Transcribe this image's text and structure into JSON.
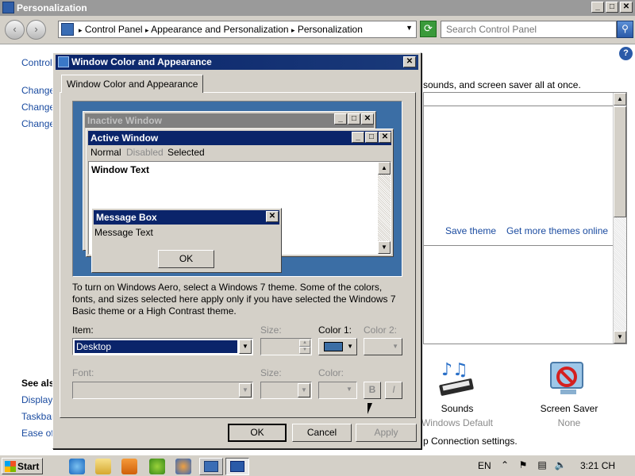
{
  "window": {
    "title": "Personalization",
    "minimize": "_",
    "maximize": "□",
    "close": "✕"
  },
  "nav": {
    "back": "‹",
    "forward": "›",
    "breadcrumb": [
      "Control Panel",
      "Appearance and Personalization",
      "Personalization"
    ],
    "search_placeholder": "Search Control Panel"
  },
  "sidebar": {
    "home_link": "Control",
    "links": [
      "Change",
      "Change",
      "Change"
    ],
    "see_also_title": "See als",
    "see_also": [
      "Display",
      "Taskbar",
      "Ease of"
    ]
  },
  "main": {
    "intro_text": "sounds, and screen saver all at once.",
    "save_theme": "Save theme",
    "get_more_themes": "Get more themes online",
    "remote_text": "p Connection settings.",
    "sounds": {
      "label": "Sounds",
      "value": "Windows Default"
    },
    "screen_saver": {
      "label": "Screen Saver",
      "value": "None"
    }
  },
  "dialog": {
    "title": "Window Color and Appearance",
    "tab": "Window Color and Appearance",
    "preview": {
      "inactive_title": "Inactive Window",
      "active_title": "Active Window",
      "menu": {
        "normal": "Normal",
        "disabled": "Disabled",
        "selected": "Selected"
      },
      "window_text": "Window Text",
      "msgbox_title": "Message Box",
      "msgbox_text": "Message Text",
      "msgbox_ok": "OK"
    },
    "description": "To turn on Windows Aero, select a Windows 7 theme.  Some of the colors, fonts, and sizes selected here apply only if you have selected the Windows 7 Basic theme or a High Contrast theme.",
    "item_label": "Item:",
    "item_value": "Desktop",
    "size_label": "Size:",
    "color1_label": "Color 1:",
    "color1_value": "#3b6ea5",
    "color2_label": "Color 2:",
    "font_label": "Font:",
    "font_size_label": "Size:",
    "font_color_label": "Color:",
    "bold": "B",
    "italic": "I",
    "ok": "OK",
    "cancel": "Cancel",
    "apply": "Apply"
  },
  "taskbar": {
    "start": "Start",
    "language": "EN",
    "clock": "3:21 CH"
  },
  "colors": {
    "desktop": "#3b6ea5",
    "active_title": "#0a246a",
    "inactive_title": "#808080",
    "face": "#d4d0c8",
    "link": "#1a4ba0"
  }
}
